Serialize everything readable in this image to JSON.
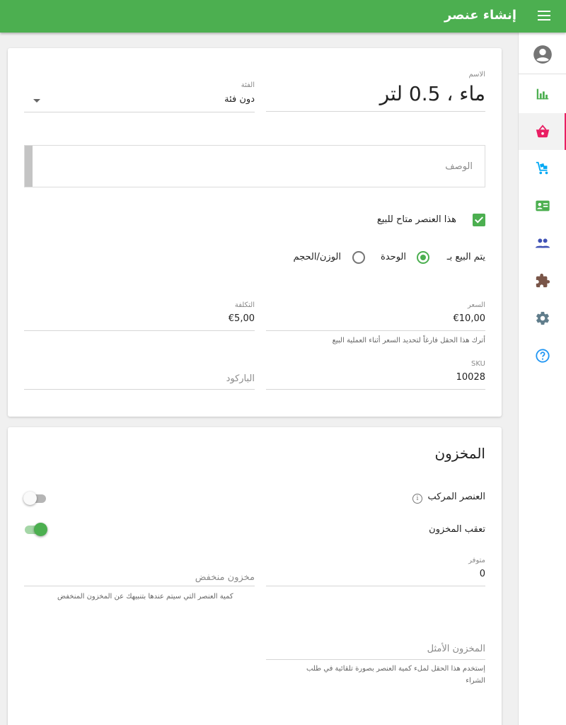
{
  "header": {
    "title": "إنشاء عنصر",
    "menu_icon": "menu-icon"
  },
  "sidebar": {
    "items": [
      {
        "name": "account",
        "icon": "account-circle-icon",
        "color": "#757575"
      },
      {
        "name": "reports",
        "icon": "bar-chart-icon",
        "color": "#4caf50"
      },
      {
        "name": "items",
        "icon": "basket-icon",
        "color": "#e91e63",
        "active": true
      },
      {
        "name": "purchase",
        "icon": "cart-icon",
        "color": "#03a9f4"
      },
      {
        "name": "customers",
        "icon": "contact-card-icon",
        "color": "#4caf50"
      },
      {
        "name": "employees",
        "icon": "people-icon",
        "color": "#3f51b5"
      },
      {
        "name": "apps",
        "icon": "puzzle-icon",
        "color": "#795548"
      },
      {
        "name": "settings",
        "icon": "gear-icon",
        "color": "#607d8b"
      },
      {
        "name": "help",
        "icon": "help-icon",
        "color": "#2196f3"
      }
    ],
    "active_color": "#e91e63"
  },
  "item_card": {
    "name_label": "الاسم",
    "name_value": "ماء ، 0.5 لتر",
    "category_label": "الفئة",
    "category_value": "دون فئة",
    "description_placeholder": "الوصف",
    "available_for_sale_label": "هذا العنصر متاح للبيع",
    "available_for_sale": true,
    "sold_by_label": "يتم البيع بـ",
    "sold_by_options": [
      "الوحدة",
      "الوزن/الحجم"
    ],
    "sold_by_selected": "الوحدة",
    "price_label": "السعر",
    "price_value": "€10,00",
    "price_hint": "أترك هذا الحقل فارغاً لتحديد السعر أثناء العملية البيع",
    "cost_label": "التكلفة",
    "cost_value": "€5,00",
    "sku_label": "SKU",
    "sku_value": "10028",
    "barcode_placeholder": "الباركود"
  },
  "inventory_card": {
    "title": "المخزون",
    "composite_label": "العنصر المركب",
    "composite_on": false,
    "track_stock_label": "تعقب المخزون",
    "track_stock_on": true,
    "in_stock_label": "متوفر",
    "in_stock_value": "0",
    "low_stock_placeholder": "مخزون منخفض",
    "low_stock_hint": "كمية العنصر التي سيتم عندها بتنبيهك عن المخزون المنخفض",
    "optimal_stock_placeholder": "المخزون الأمثل",
    "optimal_stock_hint_line1": "إستخدم هذا الحقل لملء كمية العنصر بصورة تلقائية في طلب",
    "optimal_stock_hint_line2": "الشراء"
  },
  "colors": {
    "primary": "#4caf50",
    "accent": "#e91e63"
  }
}
